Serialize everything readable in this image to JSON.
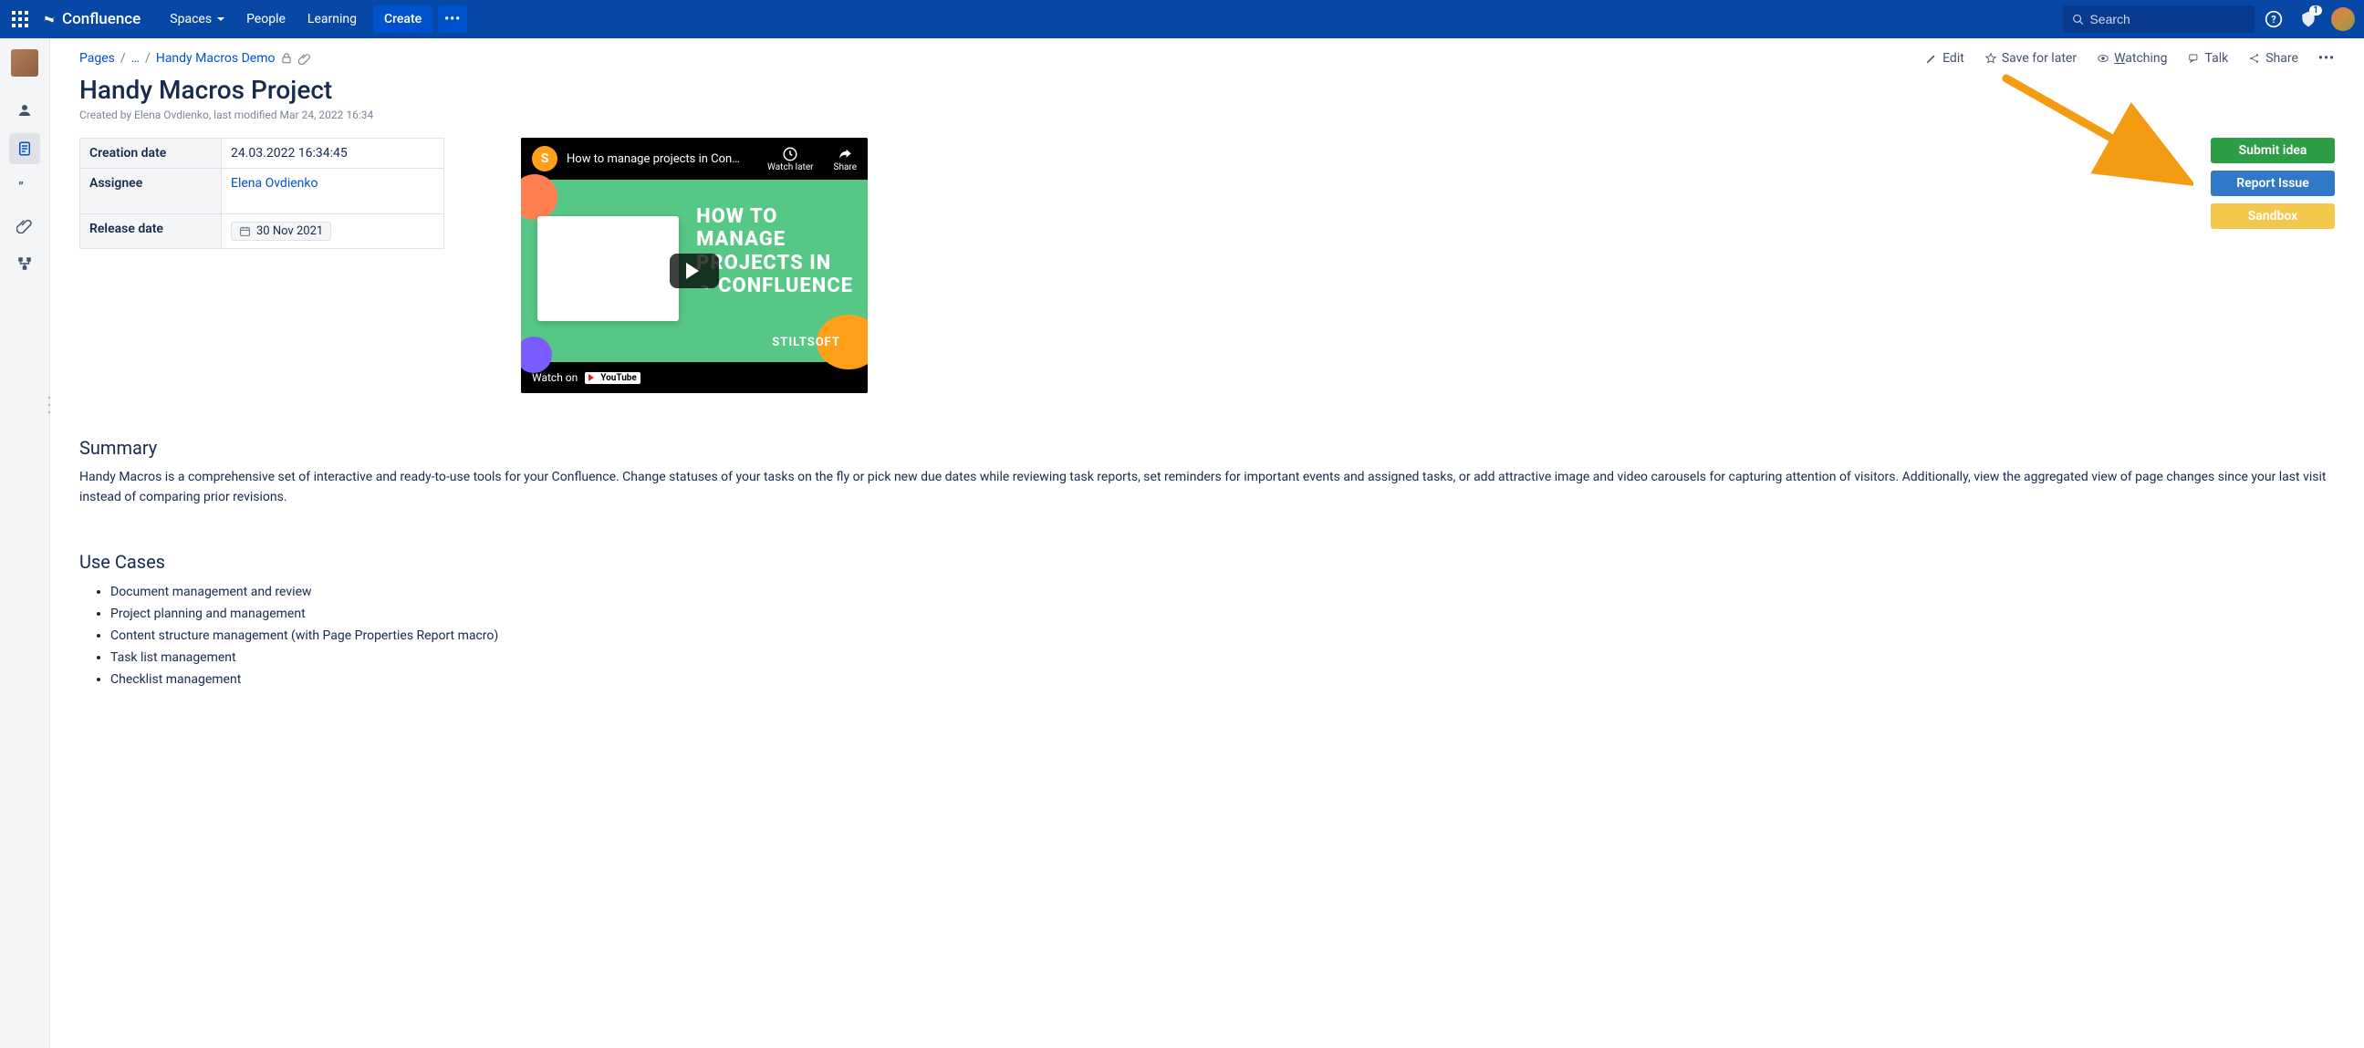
{
  "topnav": {
    "product": "Confluence",
    "menu": {
      "spaces": "Spaces",
      "people": "People",
      "learning": "Learning"
    },
    "create": "Create",
    "search_placeholder": "Search",
    "notif_count": "1"
  },
  "breadcrumb": {
    "root": "Pages",
    "ellipsis": "…",
    "current": "Handy Macros Demo"
  },
  "page_actions": {
    "edit": "Edit",
    "save": "Save for later",
    "watching": "Watching",
    "talk": "Talk",
    "share": "Share"
  },
  "page": {
    "title": "Handy Macros Project",
    "byline": "Created by Elena Ovdienko, last modified Mar 24, 2022 16:34"
  },
  "props": {
    "creation_label": "Creation date",
    "creation_value": "24.03.2022 16:34:45",
    "assignee_label": "Assignee",
    "assignee_value": "Elena Ovdienko",
    "release_label": "Release date",
    "release_value": "30 Nov 2021"
  },
  "video": {
    "title": "How to manage projects in Con…",
    "watch_later": "Watch later",
    "share": "Share",
    "overlay_line1": "HOW TO",
    "overlay_line2": "MANAGE",
    "overlay_line3": "PROJECTS IN",
    "overlay_line4": "CONFLUENCE",
    "brand": "STILTSOFT",
    "watch_on": "Watch on",
    "youtube": "YouTube"
  },
  "buttons": {
    "submit": "Submit idea",
    "report": "Report Issue",
    "sandbox": "Sandbox"
  },
  "summary": {
    "heading": "Summary",
    "text": "Handy Macros is a comprehensive set of interactive and ready-to-use tools for your Confluence. Change statuses of your tasks on the fly or pick new due dates while reviewing task reports, set reminders for important events and assigned tasks, or add attractive image and video carousels for capturing attention of visitors. Additionally, view the aggregated view of page changes since your last visit instead of comparing prior revisions."
  },
  "usecases": {
    "heading": "Use Cases",
    "items": [
      "Document management and review",
      "Project planning and management",
      "Content structure management (with Page Properties Report macro)",
      "Task list management",
      "Checklist management"
    ]
  }
}
